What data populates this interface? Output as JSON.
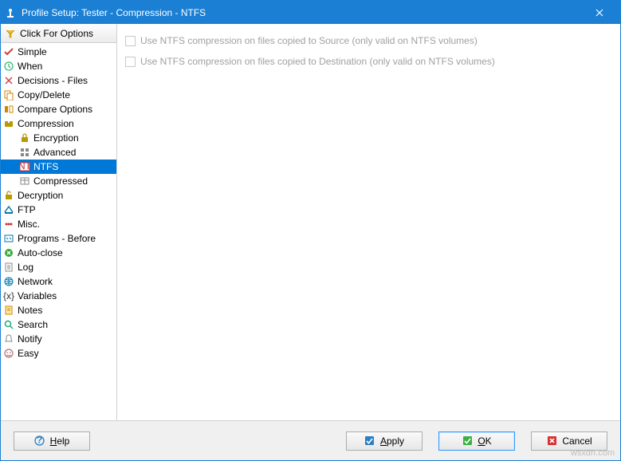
{
  "window": {
    "title": "Profile Setup: Tester - Compression - NTFS"
  },
  "sidebar": {
    "options_label": "Click For Options",
    "items": [
      {
        "label": "Simple",
        "icon": "check",
        "color": "#d22"
      },
      {
        "label": "When",
        "icon": "clock",
        "color": "#3b7"
      },
      {
        "label": "Decisions - Files",
        "icon": "decide",
        "color": "#c44"
      },
      {
        "label": "Copy/Delete",
        "icon": "copy",
        "color": "#c80"
      },
      {
        "label": "Compare Options",
        "icon": "compare",
        "color": "#c80"
      },
      {
        "label": "Compression",
        "icon": "compress",
        "color": "#b90"
      },
      {
        "label": "Encryption",
        "icon": "lock",
        "color": "#b90",
        "child": true
      },
      {
        "label": "Advanced",
        "icon": "grid",
        "color": "#888",
        "child": true
      },
      {
        "label": "NTFS",
        "icon": "ntfs",
        "color": "#c33",
        "child": true,
        "selected": true
      },
      {
        "label": "Compressed",
        "icon": "box",
        "color": "#888",
        "child": true
      },
      {
        "label": "Decryption",
        "icon": "unlock",
        "color": "#b90"
      },
      {
        "label": "FTP",
        "icon": "ftp",
        "color": "#07a"
      },
      {
        "label": "Misc.",
        "icon": "misc",
        "color": "#c33"
      },
      {
        "label": "Programs - Before",
        "icon": "prog",
        "color": "#07a"
      },
      {
        "label": "Auto-close",
        "icon": "close",
        "color": "#3a3"
      },
      {
        "label": "Log",
        "icon": "log",
        "color": "#888"
      },
      {
        "label": "Network",
        "icon": "net",
        "color": "#07a"
      },
      {
        "label": "Variables",
        "icon": "vars",
        "color": "#333"
      },
      {
        "label": "Notes",
        "icon": "note",
        "color": "#c80"
      },
      {
        "label": "Search",
        "icon": "search",
        "color": "#2a7"
      },
      {
        "label": "Notify",
        "icon": "notify",
        "color": "#888"
      },
      {
        "label": "Easy",
        "icon": "easy",
        "color": "#a55"
      }
    ]
  },
  "content": {
    "checkbox1": "Use NTFS compression on files copied to Source (only valid on NTFS volumes)",
    "checkbox2": "Use NTFS compression on files copied to Destination (only valid on NTFS volumes)"
  },
  "buttons": {
    "help": "Help",
    "apply": "Apply",
    "ok": "OK",
    "cancel": "Cancel"
  },
  "watermark": "wsxdn.com"
}
